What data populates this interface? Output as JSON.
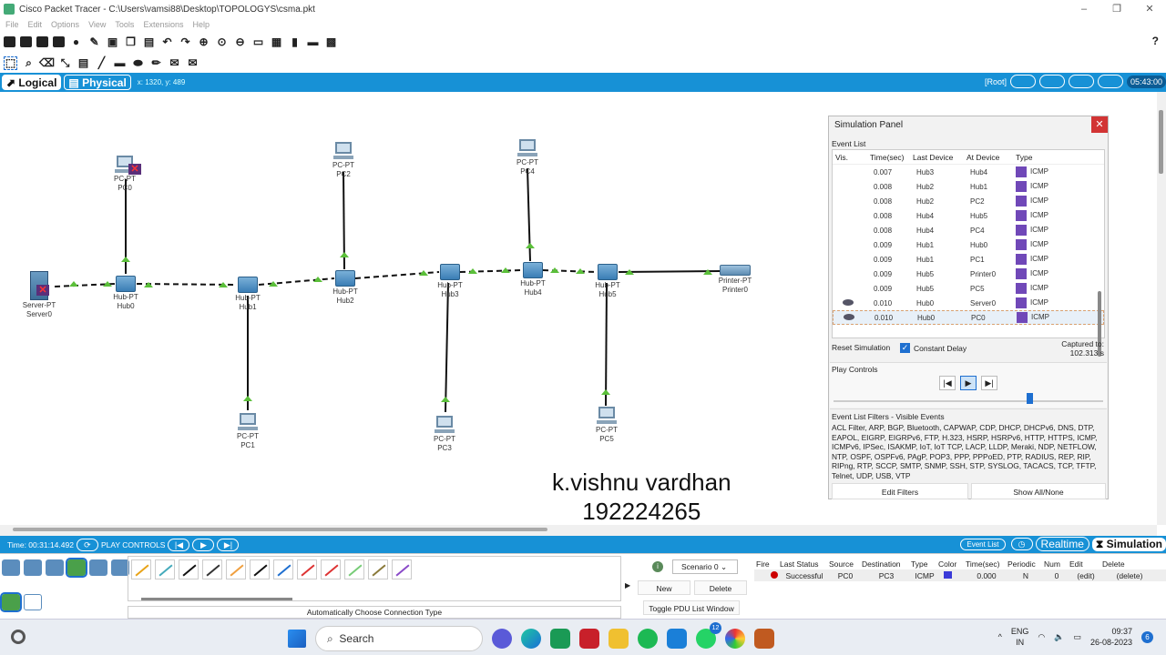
{
  "window": {
    "title": "Cisco Packet Tracer - C:\\Users\\vamsi88\\Desktop\\TOPOLOGYS\\csma.pkt",
    "minimize": "–",
    "maximize": "❐",
    "close": "✕"
  },
  "menu": [
    "File",
    "Edit",
    "Options",
    "View",
    "Tools",
    "Extensions",
    "Help"
  ],
  "help_icon": "?",
  "modebar": {
    "logical": "Logical",
    "physical": "Physical",
    "coords": "x: 1320, y: 489",
    "root": "[Root]",
    "clock": "05:43:00"
  },
  "devices": [
    {
      "id": "server0",
      "type": "Server-PT",
      "name": "Server0"
    },
    {
      "id": "hub0",
      "type": "Hub-PT",
      "name": "Hub0"
    },
    {
      "id": "hub1",
      "type": "Hub-PT",
      "name": "Hub1"
    },
    {
      "id": "hub2",
      "type": "Hub-PT",
      "name": "Hub2"
    },
    {
      "id": "hub3",
      "type": "Hub-PT",
      "name": "Hub3"
    },
    {
      "id": "hub4",
      "type": "Hub-PT",
      "name": "Hub4"
    },
    {
      "id": "hub5",
      "type": "Hub-PT",
      "name": "Hub5"
    },
    {
      "id": "printer0",
      "type": "Printer-PT",
      "name": "Printer0"
    },
    {
      "id": "pc0",
      "type": "PC-PT",
      "name": "PC0"
    },
    {
      "id": "pc1",
      "type": "PC-PT",
      "name": "PC1"
    },
    {
      "id": "pc2",
      "type": "PC-PT",
      "name": "PC2"
    },
    {
      "id": "pc3",
      "type": "PC-PT",
      "name": "PC3"
    },
    {
      "id": "pc4",
      "type": "PC-PT",
      "name": "PC4"
    },
    {
      "id": "pc5",
      "type": "PC-PT",
      "name": "PC5"
    }
  ],
  "signature": {
    "name": "k.vishnu vardhan",
    "id": "192224265"
  },
  "sim_panel": {
    "title": "Simulation Panel",
    "close": "✕",
    "event_list_label": "Event List",
    "columns": [
      "Vis.",
      "Time(sec)",
      "Last Device",
      "At Device",
      "Type"
    ],
    "events": [
      {
        "vis": false,
        "time": "0.007",
        "last": "Hub3",
        "at": "Hub4",
        "type": "ICMP"
      },
      {
        "vis": false,
        "time": "0.008",
        "last": "Hub2",
        "at": "Hub1",
        "type": "ICMP"
      },
      {
        "vis": false,
        "time": "0.008",
        "last": "Hub2",
        "at": "PC2",
        "type": "ICMP"
      },
      {
        "vis": false,
        "time": "0.008",
        "last": "Hub4",
        "at": "Hub5",
        "type": "ICMP"
      },
      {
        "vis": false,
        "time": "0.008",
        "last": "Hub4",
        "at": "PC4",
        "type": "ICMP"
      },
      {
        "vis": false,
        "time": "0.009",
        "last": "Hub1",
        "at": "Hub0",
        "type": "ICMP"
      },
      {
        "vis": false,
        "time": "0.009",
        "last": "Hub1",
        "at": "PC1",
        "type": "ICMP"
      },
      {
        "vis": false,
        "time": "0.009",
        "last": "Hub5",
        "at": "Printer0",
        "type": "ICMP"
      },
      {
        "vis": false,
        "time": "0.009",
        "last": "Hub5",
        "at": "PC5",
        "type": "ICMP"
      },
      {
        "vis": true,
        "time": "0.010",
        "last": "Hub0",
        "at": "Server0",
        "type": "ICMP"
      },
      {
        "vis": true,
        "time": "0.010",
        "last": "Hub0",
        "at": "PC0",
        "type": "ICMP",
        "selected": true
      }
    ],
    "reset": "Reset Simulation",
    "constant_delay": "Constant Delay",
    "captured_label": "Captured to:",
    "captured_value": "102.313 s",
    "play_controls": "Play Controls",
    "btn_back": "|◀",
    "btn_play": "▶",
    "btn_forward": "▶|",
    "filters_label": "Event List Filters - Visible Events",
    "filters_text": "ACL Filter, ARP, BGP, Bluetooth, CAPWAP, CDP, DHCP, DHCPv6, DNS, DTP, EAPOL, EIGRP, EIGRPv6, FTP, H.323, HSRP, HSRPv6, HTTP, HTTPS, ICMP, ICMPv6, IPSec, ISAKMP, IoT, IoT TCP, LACP, LLDP, Meraki, NDP, NETFLOW, NTP, OSPF, OSPFv6, PAgP, POP3, PPP, PPPoED, PTP, RADIUS, REP, RIP, RIPng, RTP, SCCP, SMTP, SNMP, SSH, STP, SYSLOG, TACACS, TCP, TFTP, Telnet, UDP, USB, VTP",
    "edit_filters": "Edit Filters",
    "show_all": "Show All/None",
    "type_color": "#7048b8"
  },
  "statusbar": {
    "time": "Time: 00:31:14.492",
    "play_controls": "PLAY CONTROLS",
    "event_list": "Event List",
    "realtime": "Realtime",
    "simulation": "Simulation"
  },
  "bottom": {
    "conn_label": "Automatically Choose Connection Type",
    "scenario": "Scenario 0",
    "new": "New",
    "delete": "Delete",
    "toggle": "Toggle PDU List Window",
    "pdu_columns": [
      "Fire",
      "Last Status",
      "Source",
      "Destination",
      "Type",
      "Color",
      "Time(sec)",
      "Periodic",
      "Num",
      "Edit",
      "Delete"
    ],
    "pdu_rows": [
      {
        "status": "Successful",
        "source": "PC0",
        "dest": "PC3",
        "type": "ICMP",
        "time": "0.000",
        "periodic": "N",
        "num": "0",
        "edit": "(edit)",
        "delete": "(delete)"
      }
    ]
  },
  "taskbar": {
    "search": "Search",
    "lang1": "ENG",
    "lang2": "IN",
    "time": "09:37",
    "date": "26-08-2023",
    "notif": "6",
    "whatsapp_badge": "12",
    "up_arrow": "^"
  }
}
